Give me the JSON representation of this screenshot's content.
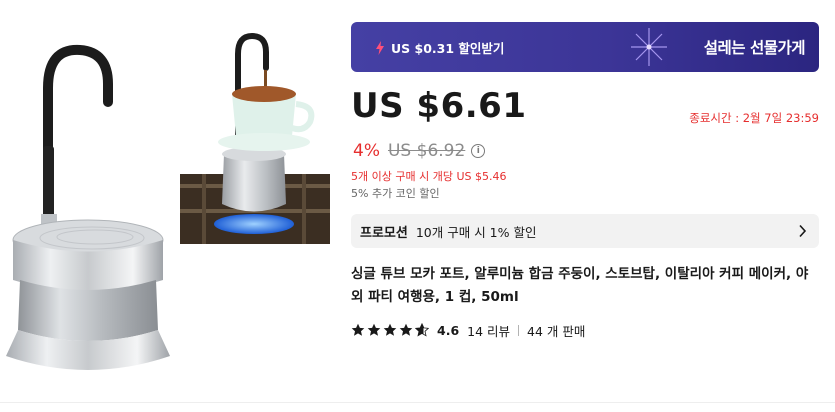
{
  "coupon": {
    "label": "US $0.31 할인받기",
    "promo_title": "설레는 선물가게",
    "icon": "bolt-icon",
    "accent_color": "#3f3a9c"
  },
  "price": {
    "current": "US $6.61",
    "discount_pct": "4%",
    "original": "US $6.92",
    "timer": "종료시간 :  2월 7일 23:59",
    "bulk_note": "5개 이상 구매 시 개당 US $5.46",
    "coin_note": "5% 추가 코인 할인"
  },
  "promotion": {
    "tag": "프로모션",
    "text": "10개 구매 시 1% 할인"
  },
  "product": {
    "title": "싱글 튜브 모카 포트, 알루미늄 합금 주둥이, 스토브탑, 이탈리아 커피 메이커, 야외 파티 여행용, 1 컵, 50ml"
  },
  "rating": {
    "score": "4.6",
    "stars": 4.6,
    "reviews": "14 리뷰",
    "sold": "44 개 판매"
  },
  "colors": {
    "sale_red": "#e62e2e",
    "star_color": "#191919"
  }
}
